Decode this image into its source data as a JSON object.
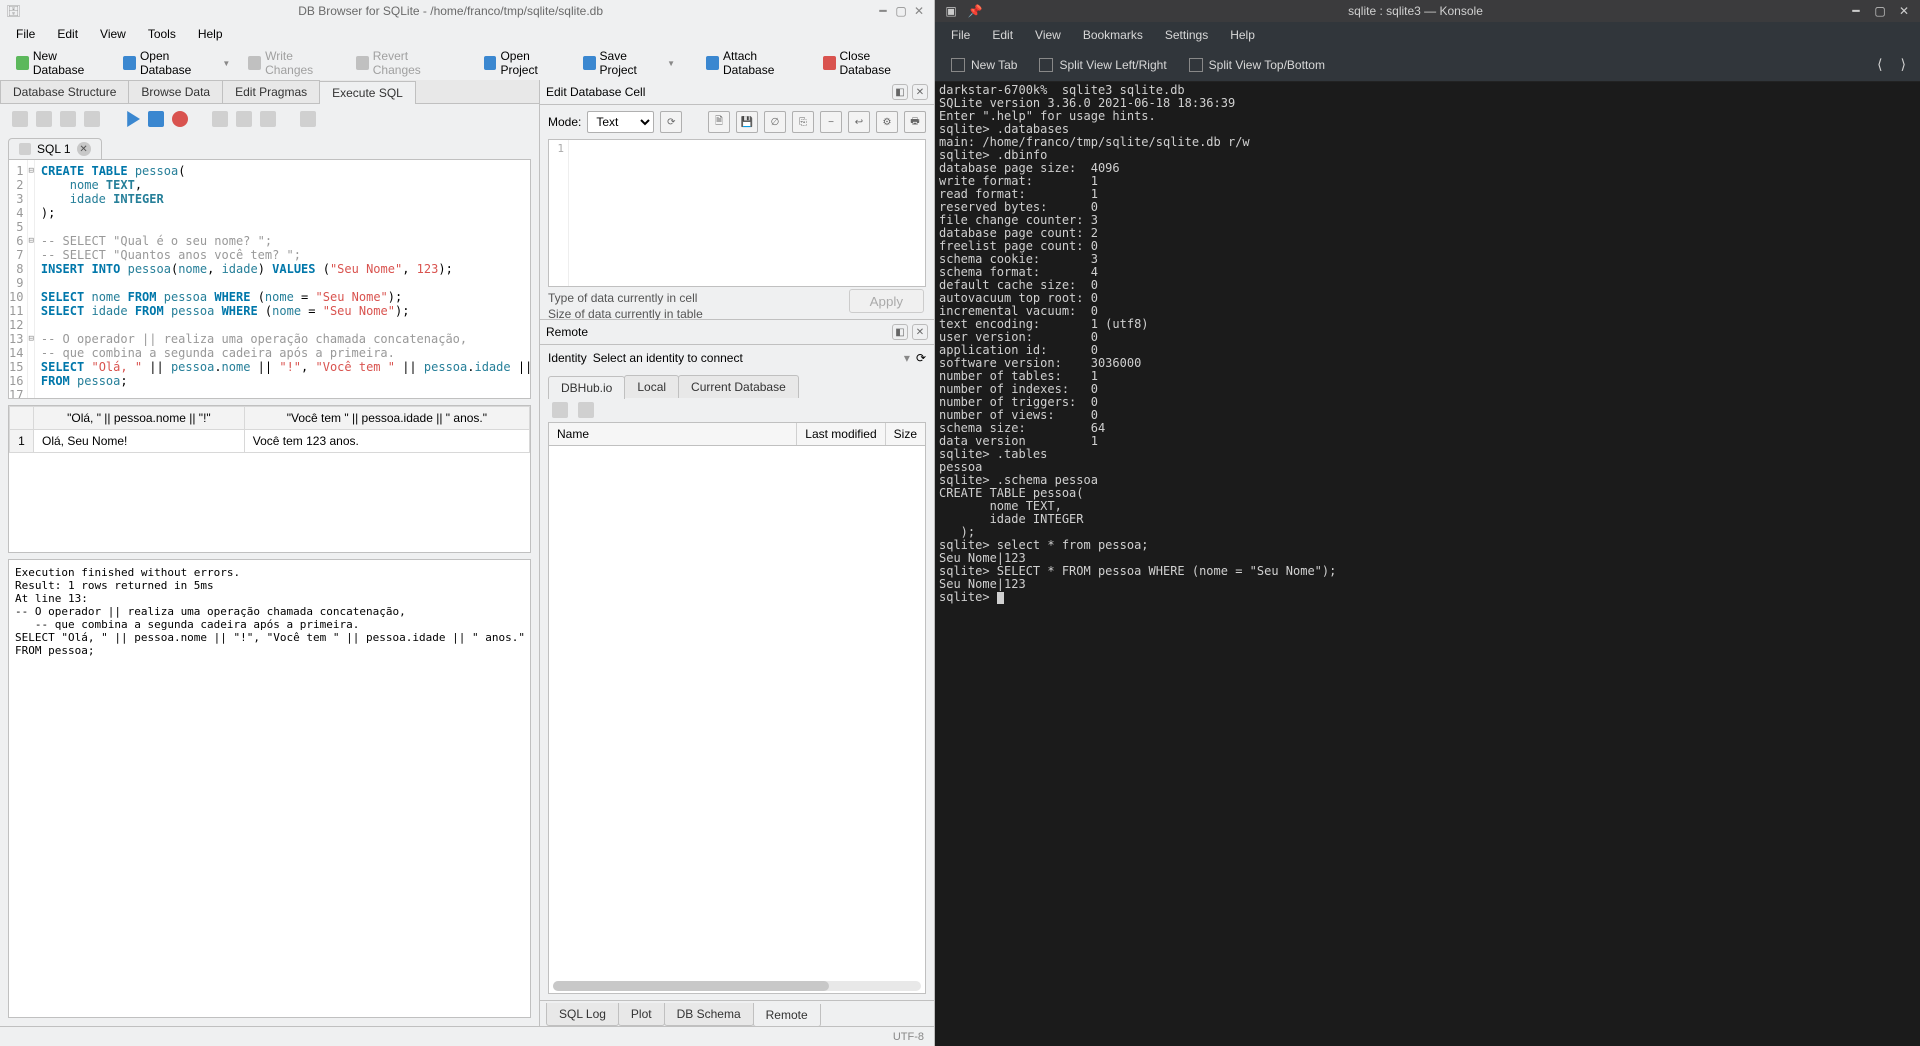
{
  "dbbrowser": {
    "title": "DB Browser for SQLite - /home/franco/tmp/sqlite/sqlite.db",
    "menu": [
      "File",
      "Edit",
      "View",
      "Tools",
      "Help"
    ],
    "toolbar": {
      "new_db": "New Database",
      "open_db": "Open Database",
      "write_changes": "Write Changes",
      "revert_changes": "Revert Changes",
      "open_project": "Open Project",
      "save_project": "Save Project",
      "attach_db": "Attach Database",
      "close_db": "Close Database"
    },
    "main_tabs": [
      "Database Structure",
      "Browse Data",
      "Edit Pragmas",
      "Execute SQL"
    ],
    "active_main_tab": 3,
    "sql_tab": {
      "name": "SQL 1"
    },
    "sql_lines": [
      {
        "n": 1,
        "f": "⊟",
        "html": "<span class='kw'>CREATE</span> <span class='kw'>TABLE</span> <span class='id'>pessoa</span>("
      },
      {
        "n": 2,
        "f": "",
        "html": "    <span class='id'>nome</span> <span class='ty'>TEXT</span>,"
      },
      {
        "n": 3,
        "f": "",
        "html": "    <span class='id'>idade</span> <span class='ty'>INTEGER</span>"
      },
      {
        "n": 4,
        "f": "",
        "html": ");"
      },
      {
        "n": 5,
        "f": "",
        "html": ""
      },
      {
        "n": 6,
        "f": "⊟",
        "html": "<span class='cm'>-- SELECT \"Qual é o seu nome? \";</span>"
      },
      {
        "n": 7,
        "f": "",
        "html": "<span class='cm'>-- SELECT \"Quantos anos você tem? \";</span>"
      },
      {
        "n": 8,
        "f": "",
        "html": "<span class='kw'>INSERT</span> <span class='kw'>INTO</span> <span class='id'>pessoa</span>(<span class='id'>nome</span>, <span class='id'>idade</span>) <span class='kw'>VALUES</span> (<span class='str'>\"Seu Nome\"</span>, <span class='nu'>123</span>);"
      },
      {
        "n": 9,
        "f": "",
        "html": ""
      },
      {
        "n": 10,
        "f": "",
        "html": "<span class='kw'>SELECT</span> <span class='id'>nome</span> <span class='kw'>FROM</span> <span class='id'>pessoa</span> <span class='kw'>WHERE</span> (<span class='id'>nome</span> = <span class='str'>\"Seu Nome\"</span>);"
      },
      {
        "n": 11,
        "f": "",
        "html": "<span class='kw'>SELECT</span> <span class='id'>idade</span> <span class='kw'>FROM</span> <span class='id'>pessoa</span> <span class='kw'>WHERE</span> (<span class='id'>nome</span> = <span class='str'>\"Seu Nome\"</span>);"
      },
      {
        "n": 12,
        "f": "",
        "html": ""
      },
      {
        "n": 13,
        "f": "⊟",
        "html": "<span class='cm'>-- O operador || realiza uma operação chamada concatenação,</span>"
      },
      {
        "n": 14,
        "f": "",
        "html": "<span class='cm'>-- que combina a segunda cadeira após a primeira.</span>"
      },
      {
        "n": 15,
        "f": "",
        "html": "<span class='kw'>SELECT</span> <span class='str'>\"Olá, \"</span> || <span class='id'>pessoa</span>.<span class='id'>nome</span> || <span class='str'>\"!\"</span>, <span class='str'>\"Você tem \"</span> || <span class='id'>pessoa</span>.<span class='id'>idade</span> || <span class='str'>\" anos.\"</span>"
      },
      {
        "n": 16,
        "f": "",
        "html": "<span class='kw'>FROM</span> <span class='id'>pessoa</span>;"
      },
      {
        "n": 17,
        "f": "",
        "html": ""
      }
    ],
    "result": {
      "headers": [
        "\"Olá, \" || pessoa.nome || \"!\"",
        "\"Você tem \" || pessoa.idade || \" anos.\""
      ],
      "rows": [
        {
          "n": "1",
          "cells": [
            "Olá, Seu Nome!",
            "Você tem 123 anos."
          ]
        }
      ]
    },
    "log": "Execution finished without errors.\nResult: 1 rows returned in 5ms\nAt line 13:\n-- O operador || realiza uma operação chamada concatenação,\n   -- que combina a segunda cadeira após a primeira.\nSELECT \"Olá, \" || pessoa.nome || \"!\", \"Você tem \" || pessoa.idade || \" anos.\"\nFROM pessoa;",
    "cell_panel": {
      "title": "Edit Database Cell",
      "mode_label": "Mode:",
      "mode_value": "Text",
      "line_no": "1",
      "type_text": "Type of data currently in cell",
      "size_text": "Size of data currently in table",
      "apply": "Apply"
    },
    "remote_panel": {
      "title": "Remote",
      "identity_label": "Identity",
      "identity_placeholder": "Select an identity to connect",
      "tabs": [
        "DBHub.io",
        "Local",
        "Current Database"
      ],
      "active_tab": 0,
      "columns": [
        "Name",
        "Last modified",
        "Size"
      ]
    },
    "bottom_tabs": [
      "SQL Log",
      "Plot",
      "DB Schema",
      "Remote"
    ],
    "active_bottom_tab": 3,
    "status": "UTF-8"
  },
  "konsole": {
    "title": "sqlite : sqlite3 — Konsole",
    "menu": [
      "File",
      "Edit",
      "View",
      "Bookmarks",
      "Settings",
      "Help"
    ],
    "toolbar": {
      "new_tab": "New Tab",
      "split_lr": "Split View Left/Right",
      "split_tb": "Split View Top/Bottom"
    },
    "lines": [
      "darkstar-6700k%  sqlite3 sqlite.db",
      "SQLite version 3.36.0 2021-06-18 18:36:39",
      "Enter \".help\" for usage hints.",
      "sqlite> .databases",
      "main: /home/franco/tmp/sqlite/sqlite.db r/w",
      "sqlite> .dbinfo",
      "database page size:  4096",
      "write format:        1",
      "read format:         1",
      "reserved bytes:      0",
      "file change counter: 3",
      "database page count: 2",
      "freelist page count: 0",
      "schema cookie:       3",
      "schema format:       4",
      "default cache size:  0",
      "autovacuum top root: 0",
      "incremental vacuum:  0",
      "text encoding:       1 (utf8)",
      "user version:        0",
      "application id:      0",
      "software version:    3036000",
      "number of tables:    1",
      "number of indexes:   0",
      "number of triggers:  0",
      "number of views:     0",
      "schema size:         64",
      "data version         1",
      "sqlite> .tables",
      "pessoa",
      "sqlite> .schema pessoa",
      "CREATE TABLE pessoa(",
      "       nome TEXT,",
      "       idade INTEGER",
      "   );",
      "sqlite> select * from pessoa;",
      "Seu Nome|123",
      "sqlite> SELECT * FROM pessoa WHERE (nome = \"Seu Nome\");",
      "Seu Nome|123",
      "sqlite> "
    ]
  }
}
